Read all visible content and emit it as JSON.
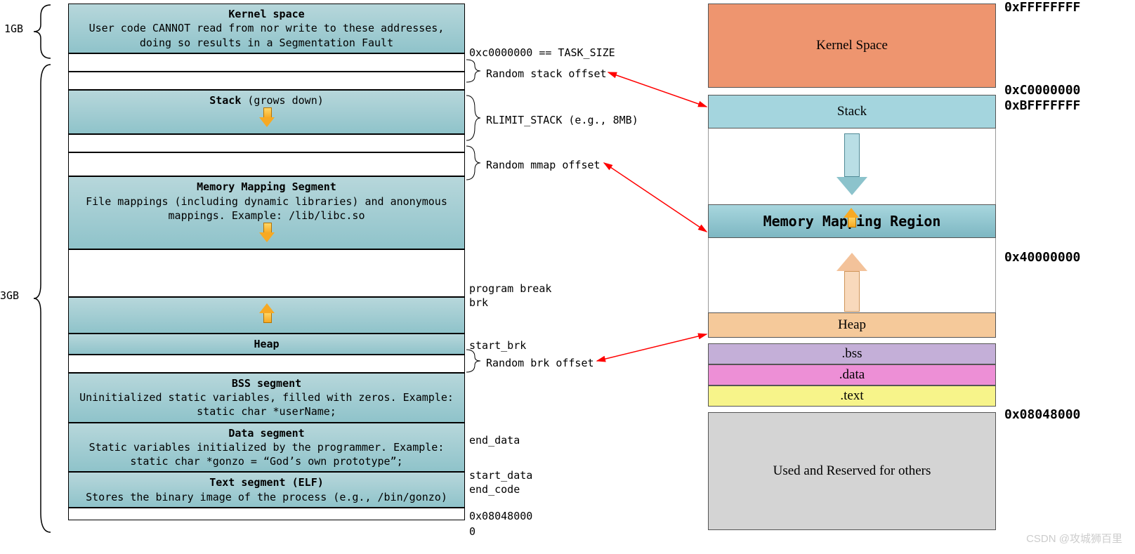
{
  "left": {
    "size_1gb": "1GB",
    "size_3gb": "3GB",
    "kernel_title": "Kernel space",
    "kernel_desc": "User code CANNOT read from nor write to these addresses, doing so results in a Segmentation Fault",
    "stack_title": "Stack",
    "stack_suffix": " (grows down)",
    "mmap_title": "Memory Mapping Segment",
    "mmap_desc": "File mappings (including dynamic libraries) and anonymous mappings. Example: /lib/libc.so",
    "heap_title": "Heap",
    "bss_title": "BSS segment",
    "bss_desc": "Uninitialized static variables, filled with zeros. Example: static char *userName;",
    "data_title": "Data segment",
    "data_desc": "Static variables initialized by the programmer. Example: static char *gonzo = “God’s own prototype”;",
    "text_title": "Text segment (ELF)",
    "text_desc": "Stores the binary image of the process (e.g., /bin/gonzo)"
  },
  "labels": {
    "task_size": "0xc0000000 == TASK_SIZE",
    "rand_stack": "Random stack offset",
    "rlimit": "RLIMIT_STACK (e.g., 8MB)",
    "rand_mmap": "Random mmap offset",
    "prog_break": "program break",
    "brk": "brk",
    "start_brk": "start_brk",
    "rand_brk": "Random brk offset",
    "end_data": "end_data",
    "start_data": "start_data",
    "end_code": "end_code",
    "addr_text": "0x08048000",
    "zero": "0"
  },
  "right": {
    "kernel": "Kernel Space",
    "stack": "Stack",
    "mmap": "Memory Mapping Region",
    "heap": "Heap",
    "bss": ".bss",
    "data": ".data",
    "text": ".text",
    "reserved": "Used and Reserved for others"
  },
  "addrs": {
    "top": "0xFFFFFFFF",
    "c0": "0xC0000000",
    "bf": "0xBFFFFFFF",
    "m40": "0x40000000",
    "base": "0x08048000"
  },
  "watermark": "CSDN @攻城狮百里"
}
